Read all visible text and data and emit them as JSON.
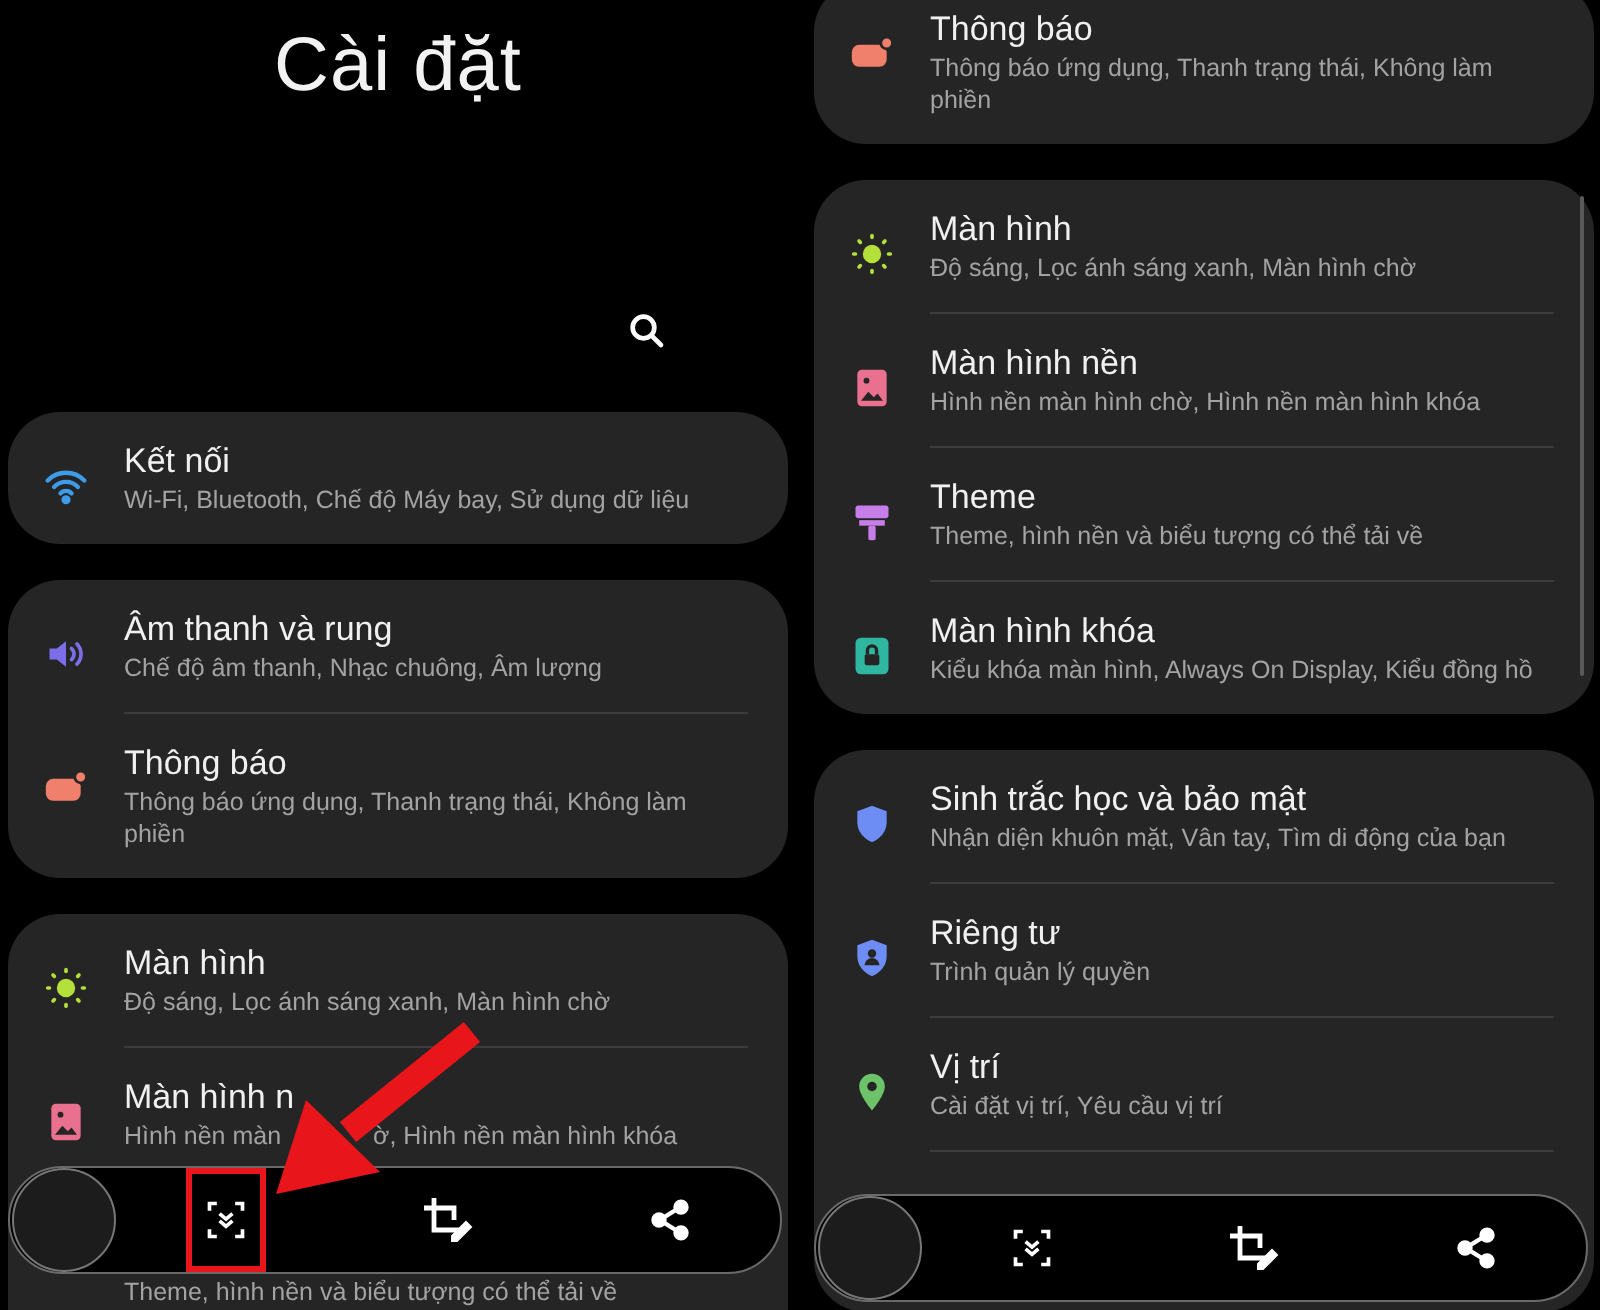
{
  "screens": [
    {
      "title": "Cài đặt",
      "search": true,
      "scrollbar": false,
      "annotation_arrow": true,
      "toolbar": {
        "scroll_capture_highlighted": true
      },
      "groups": [
        {
          "items": [
            {
              "kind": "wifi",
              "color": "#3d9be9",
              "title": "Kết nối",
              "subtitle": "Wi-Fi, Bluetooth, Chế độ Máy bay, Sử dụng dữ liệu"
            }
          ]
        },
        {
          "items": [
            {
              "kind": "volume",
              "color": "#7b6ee8",
              "title": "Âm thanh và rung",
              "subtitle": "Chế độ âm thanh, Nhạc chuông, Âm lượng"
            },
            {
              "kind": "notification",
              "color": "#f0806c",
              "title": "Thông báo",
              "subtitle": "Thông báo ứng dụng, Thanh trạng thái, Không làm phiền"
            }
          ]
        },
        {
          "items": [
            {
              "kind": "sun",
              "color": "#b3e03a",
              "title": "Màn hình",
              "subtitle": "Độ sáng, Lọc ánh sáng xanh, Màn hình chờ"
            },
            {
              "kind": "image",
              "color": "#e9708f",
              "title": "Màn hình n",
              "subtitle_parts": [
                "Hình nền màn",
                "ờ, Hình nền màn hình khóa"
              ]
            },
            {
              "subtitle": "Theme, hình nền và biểu tượng có thể tải về"
            }
          ]
        }
      ]
    },
    {
      "search": false,
      "scrollbar": true,
      "annotation_arrow": false,
      "toolbar": {
        "scroll_capture_highlighted": false
      },
      "groups": [
        {
          "items": [
            {
              "kind": "notification",
              "color": "#f0806c",
              "title": "Thông báo",
              "subtitle": "Thông báo ứng dụng, Thanh trạng thái, Không làm phiền"
            }
          ]
        },
        {
          "items": [
            {
              "kind": "sun",
              "color": "#b3e03a",
              "title": "Màn hình",
              "subtitle": "Độ sáng, Lọc ánh sáng xanh, Màn hình chờ"
            },
            {
              "kind": "image",
              "color": "#e9708f",
              "title": "Màn hình nền",
              "subtitle": "Hình nền màn hình chờ, Hình nền màn hình khóa"
            },
            {
              "kind": "brush",
              "color": "#c77ee8",
              "title": "Theme",
              "subtitle": "Theme, hình nền và biểu tượng có thể tải về"
            },
            {
              "kind": "lock",
              "color": "#2fb5a0",
              "title": "Màn hình khóa",
              "subtitle": "Kiểu khóa màn hình, Always On Display, Kiểu đồng hồ"
            }
          ]
        },
        {
          "items": [
            {
              "kind": "shield",
              "color": "#6d8df5",
              "title": "Sinh trắc học và bảo mật",
              "subtitle": "Nhận diện khuôn mặt, Vân tay, Tìm di động của bạn"
            },
            {
              "kind": "privacy",
              "color": "#6d8df5",
              "title": "Riêng tư",
              "subtitle": "Trình quản lý quyền"
            },
            {
              "kind": "pin",
              "color": "#6cc36a",
              "title": "Vị trí",
              "subtitle": "Cài đặt vị trí, Yêu cầu vị trí"
            }
          ]
        }
      ]
    }
  ]
}
